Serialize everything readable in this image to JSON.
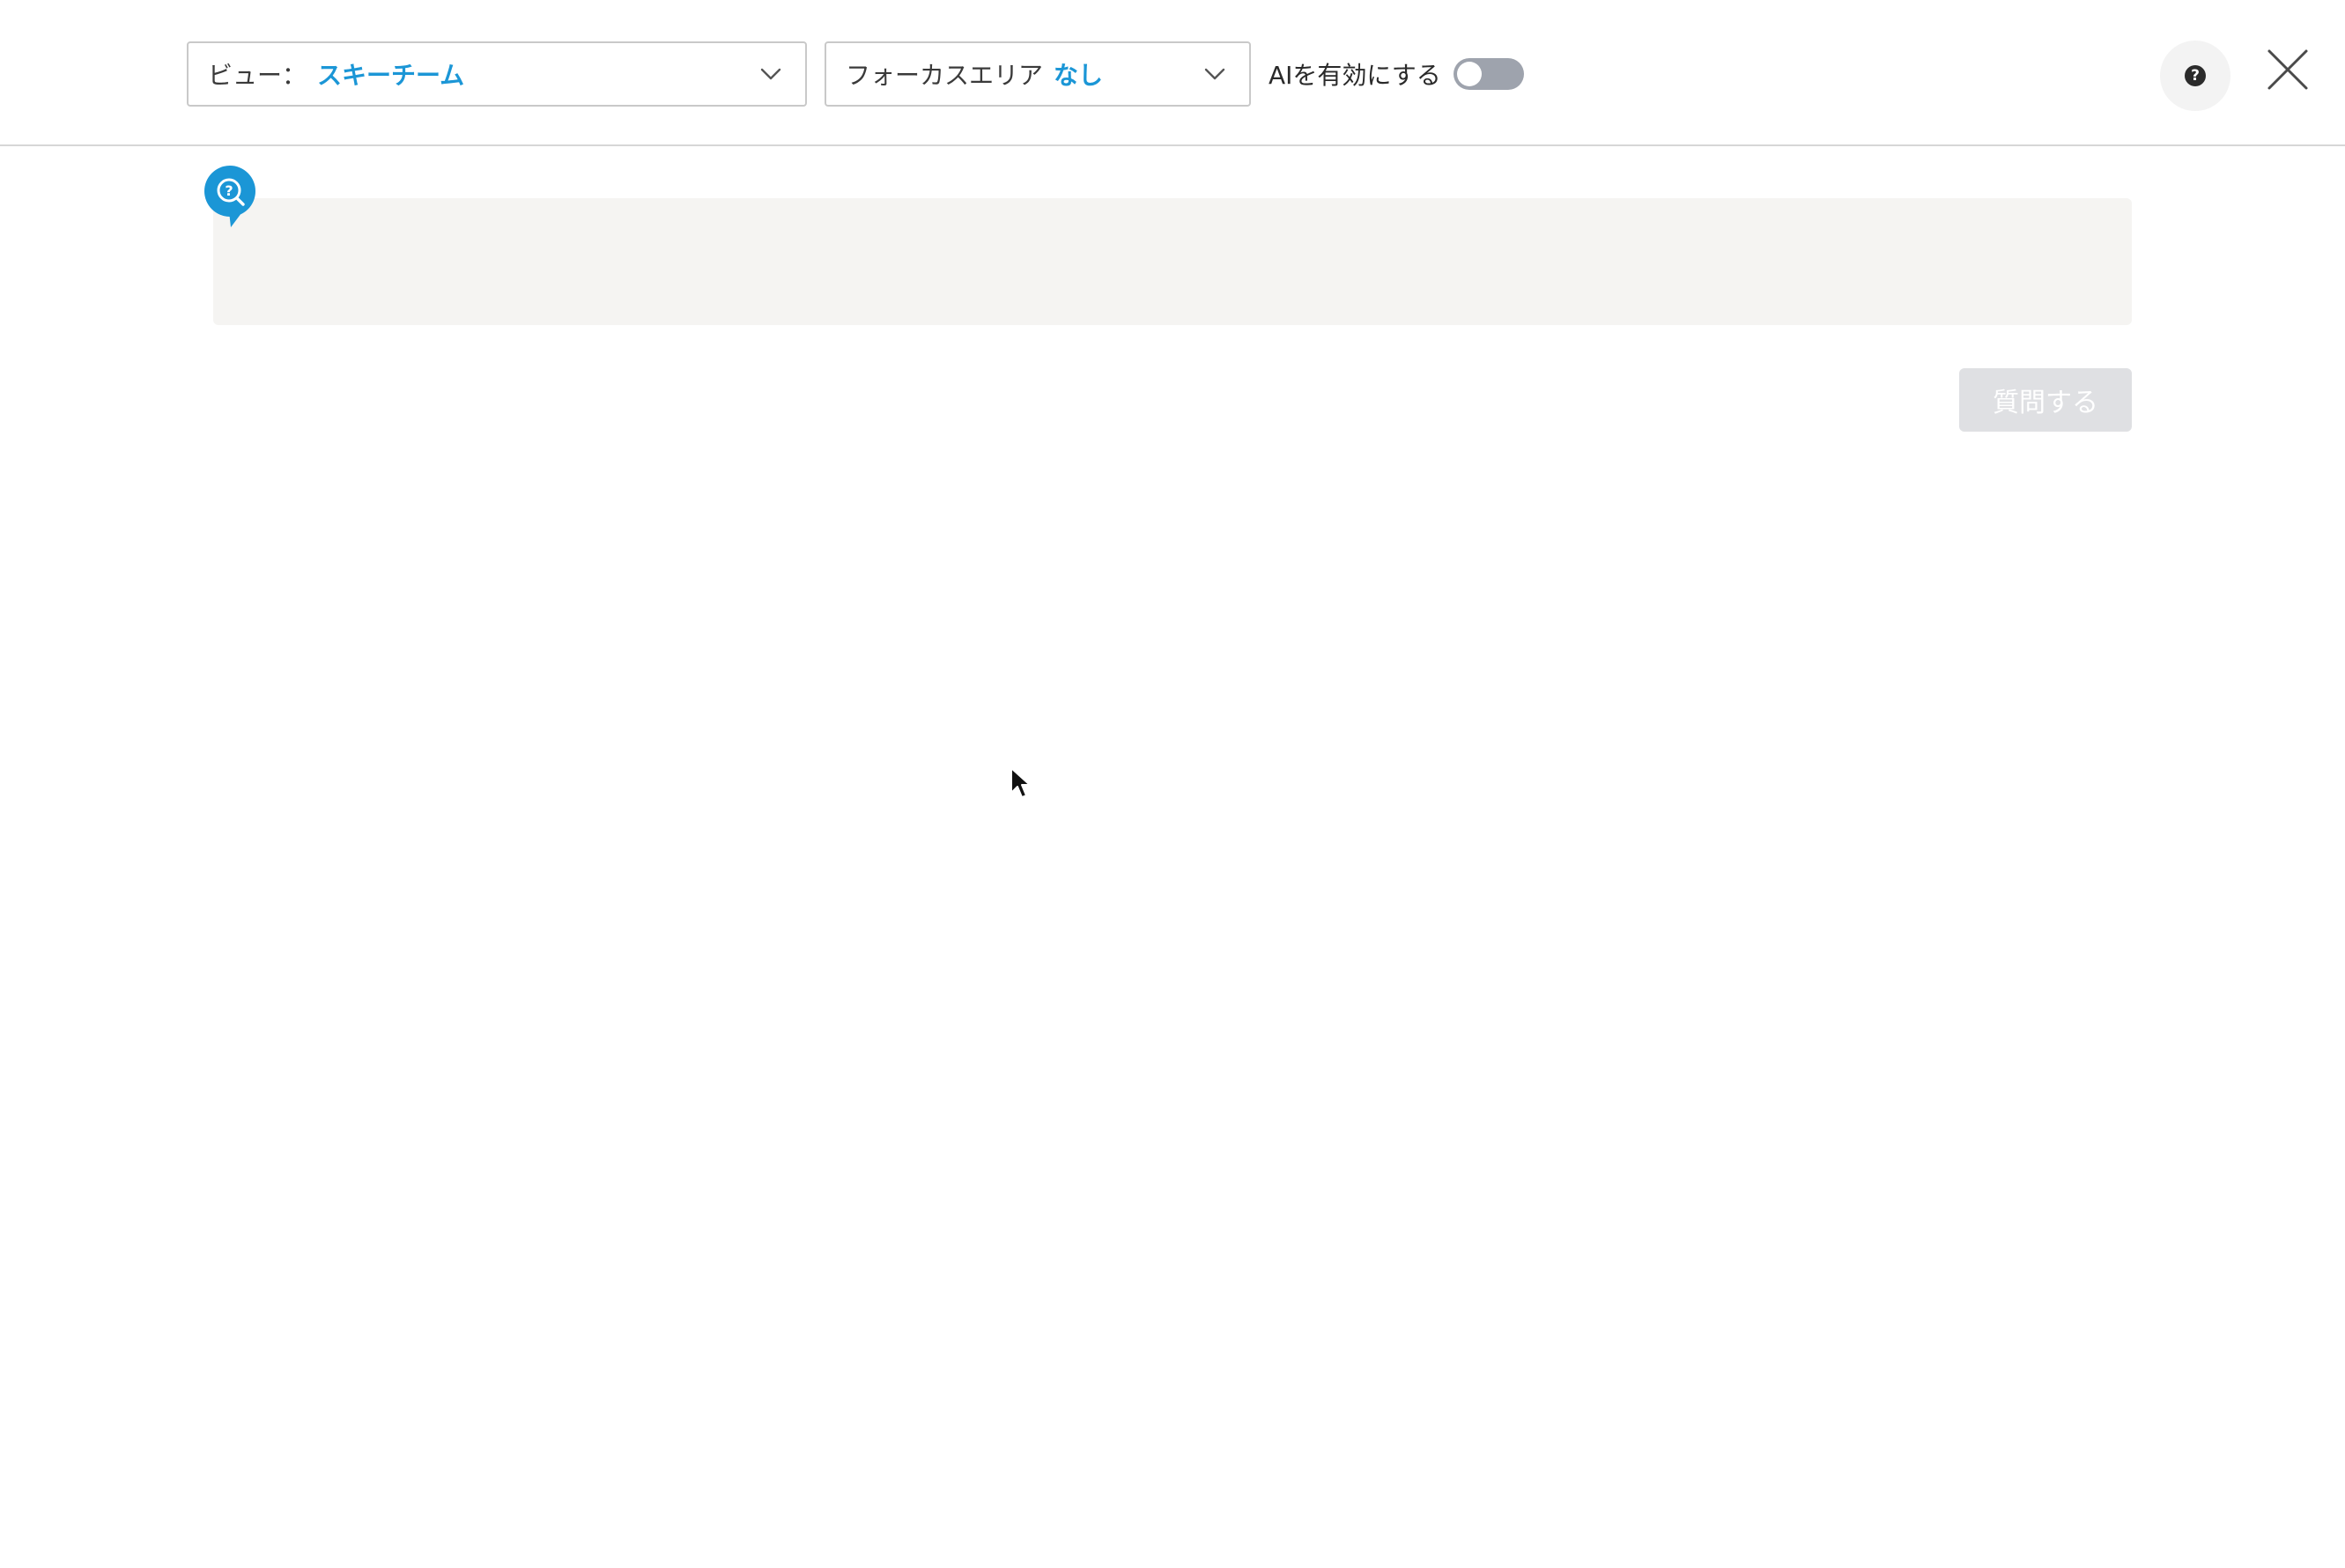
{
  "header": {
    "view_select": {
      "label": "ビュー：",
      "value": "スキーチーム"
    },
    "focus_select": {
      "label": "フォーカスエリア",
      "value": "なし"
    },
    "ai_toggle": {
      "label": "AIを有効にする",
      "enabled": false
    },
    "help_icon": "help-icon",
    "close_icon": "close-icon"
  },
  "main": {
    "question_icon": "question-search-icon",
    "question_input": {
      "value": "",
      "placeholder": ""
    },
    "ask_button_label": "質問する"
  },
  "colors": {
    "accent": "#1b96d6",
    "toggle_off": "#9ea3ad",
    "input_bg": "#f5f4f2",
    "disabled_button": "#dfe0e3"
  }
}
